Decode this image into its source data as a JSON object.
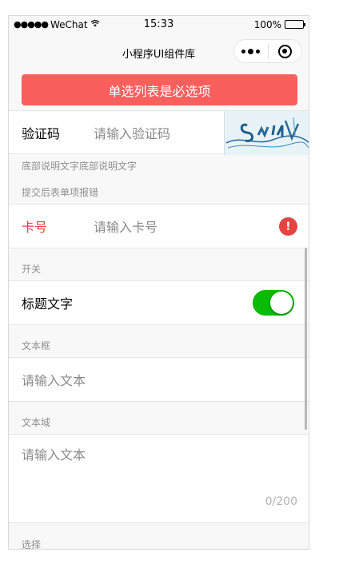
{
  "status_bar": {
    "signal": "●●●●●",
    "carrier": "WeChat",
    "wifi_icon": "wifi-icon",
    "time": "15:33",
    "battery": "100%",
    "battery_level": 1.0
  },
  "nav": {
    "title": "小程序UI组件库",
    "more_icon": "more-dots-icon",
    "close_icon": "target-close-icon"
  },
  "form": {
    "top_error": "单选列表是必选项",
    "captcha": {
      "label": "验证码",
      "placeholder": "请输入验证码"
    },
    "footer_note": "底部说明文字底部说明文字",
    "error_section_title": "提交后表单项报错",
    "card": {
      "label": "卡号",
      "placeholder": "请输入卡号",
      "warn_icon": "!"
    },
    "switch_section_title": "开关",
    "switch": {
      "label": "标题文字",
      "on": true
    },
    "input_section_title": "文本框",
    "input": {
      "placeholder": "请输入文本"
    },
    "textarea_section_title": "文本域",
    "textarea": {
      "placeholder": "请输入文本",
      "counter": "0/200"
    },
    "select_section_title": "选择"
  },
  "colors": {
    "error_red": "#e64340",
    "top_error_bg": "#f85f5d",
    "switch_green": "#09bb07",
    "muted_text": "#8f8f8f"
  }
}
